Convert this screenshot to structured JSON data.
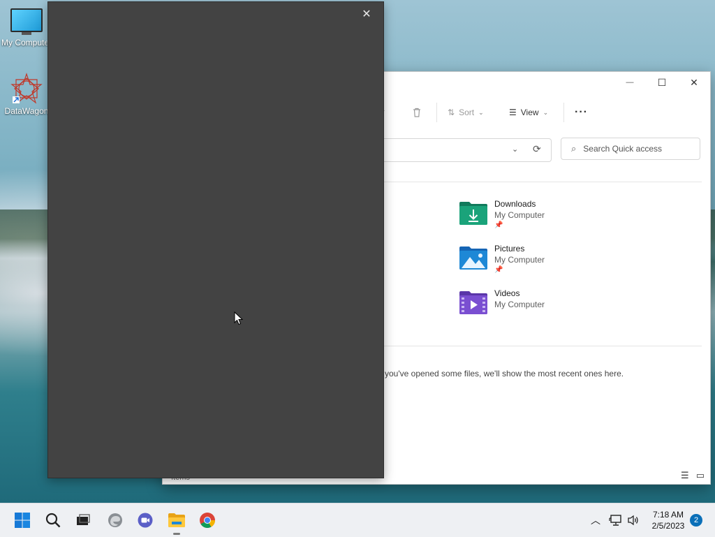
{
  "desktop": {
    "icons": [
      {
        "label": "My Computer",
        "icon": "monitor-icon"
      },
      {
        "label": "DataWagon",
        "icon": "datawagon-logo-icon"
      }
    ]
  },
  "dark_window": {
    "close_label": "✕"
  },
  "explorer": {
    "window_controls": {
      "minimize": "—",
      "maximize": "☐",
      "close": "✕"
    },
    "toolbar": {
      "sort_label": "Sort",
      "view_label": "View",
      "more_label": "···"
    },
    "search": {
      "placeholder": "Search Quick access"
    },
    "quick_access": [
      {
        "name": "Downloads",
        "location": "My Computer",
        "pinned": true,
        "color": "#1aa37a"
      },
      {
        "name": "Pictures",
        "location": "My Computer",
        "pinned": true,
        "color": "#1e88d6"
      },
      {
        "name": "Videos",
        "location": "My Computer",
        "pinned": false,
        "color": "#7a4fd1"
      }
    ],
    "recent_message": "you've opened some files, we'll show the most recent ones here.",
    "status_text": "Items"
  },
  "taskbar": {
    "apps": [
      "start-icon",
      "search-icon",
      "task-view-icon",
      "edge-icon",
      "teams-icon",
      "file-explorer-icon",
      "chrome-icon"
    ],
    "clock_time": "7:18 AM",
    "clock_date": "2/5/2023",
    "notification_count": "2"
  }
}
